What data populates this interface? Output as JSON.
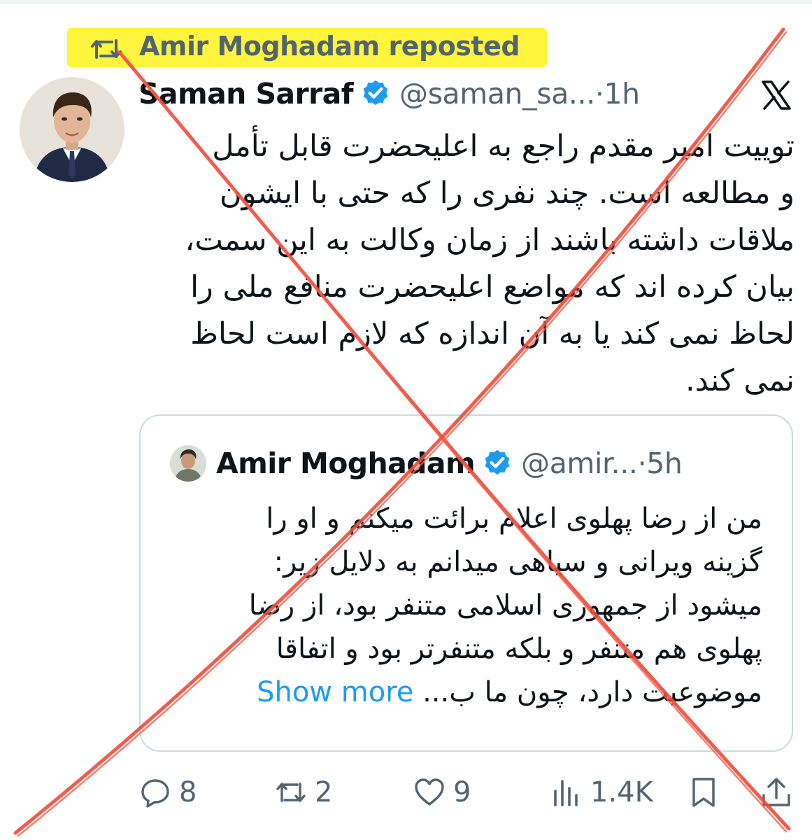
{
  "repost": {
    "label": "Amir Moghadam reposted",
    "icon": "repost-icon"
  },
  "tweet": {
    "author_name": "Saman Sarraf",
    "handle": "@saman_sa...",
    "separator": "·",
    "time": "1h",
    "platform_icon": "x-logo-icon",
    "body_lines": [
      "توییت امیر مقدم راجع به اعلیحضرت قابل تأمل",
      "و مطالعه است. چند نفری را که حتی با ایشون",
      "ملاقات داشته باشند از زمان وکالت به این سمت،",
      "بیان کرده اند که مواضع اعلیحضرت منافع ملی را",
      "لحاظ نمی کند یا به آن اندازه که لازم است لحاظ",
      "نمی کند."
    ]
  },
  "quote": {
    "author_name": "Amir Moghadam",
    "handle": "@amir...",
    "separator": "·",
    "time": "5h",
    "body_lines": [
      "من از رضا پهلوی اعلام برائت میکنم و او را",
      "گزینه ویرانی و سیاهی میدانم به دلایل زیر:",
      "میشود از جمهوری اسلامی متنفر بود، از رضا",
      "پهلوی هم متنفر و بلکه متنفرتر بود و اتفاقا",
      "موضوعیت دارد، چون ما ب..."
    ],
    "show_more": "Show more"
  },
  "actions": {
    "replies": "8",
    "reposts": "2",
    "likes": "9",
    "views": "1.4K"
  },
  "colors": {
    "highlight": "#fff53d",
    "verified": "#1d9bf0",
    "link": "#1d9bf0",
    "muted": "#536471",
    "overlay_x": "#ef4a3a"
  }
}
